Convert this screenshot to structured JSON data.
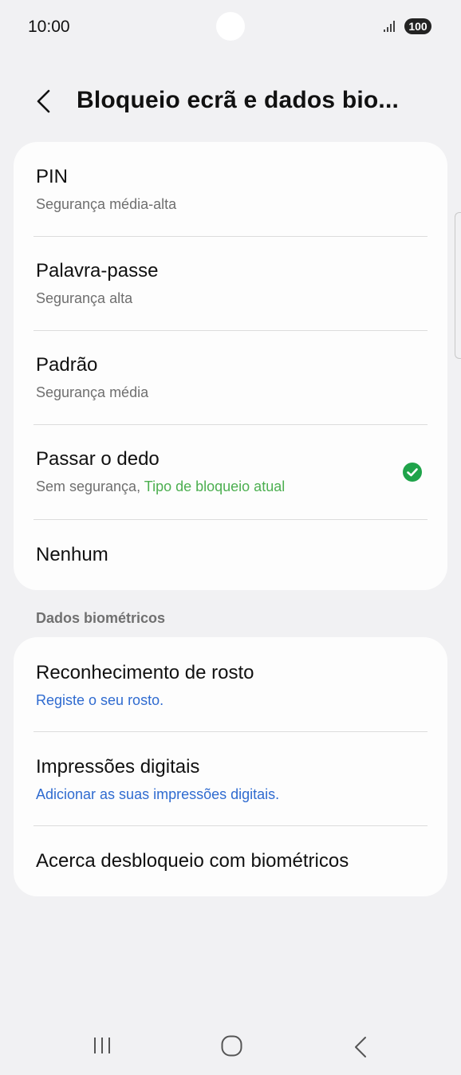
{
  "status_bar": {
    "time": "10:00",
    "battery": "100"
  },
  "header": {
    "title": "Bloqueio ecrã e dados bio..."
  },
  "lock_types": {
    "items": [
      {
        "title": "PIN",
        "subtitle": "Segurança média-alta"
      },
      {
        "title": "Palavra-passe",
        "subtitle": "Segurança alta"
      },
      {
        "title": "Padrão",
        "subtitle": "Segurança média"
      },
      {
        "title": "Passar o dedo",
        "subtitle": "Sem segurança, ",
        "subtitle_highlight": "Tipo de bloqueio atual",
        "selected": true
      },
      {
        "title": "Nenhum"
      }
    ]
  },
  "biometrics": {
    "section_header": "Dados biométricos",
    "items": [
      {
        "title": "Reconhecimento de rosto",
        "subtitle": "Registe o seu rosto."
      },
      {
        "title": "Impressões digitais",
        "subtitle": "Adicionar as suas impressões digitais."
      },
      {
        "title": "Acerca desbloqueio com biométricos"
      }
    ]
  },
  "colors": {
    "accent_green": "#4caf50",
    "link_blue": "#2f6bd0",
    "background": "#f1f1f3"
  },
  "icons": {
    "back": "chevron-left-icon",
    "selected": "check-circle-icon",
    "nav_recent": "recent-apps-icon",
    "nav_home": "home-icon",
    "nav_back": "nav-back-icon"
  }
}
